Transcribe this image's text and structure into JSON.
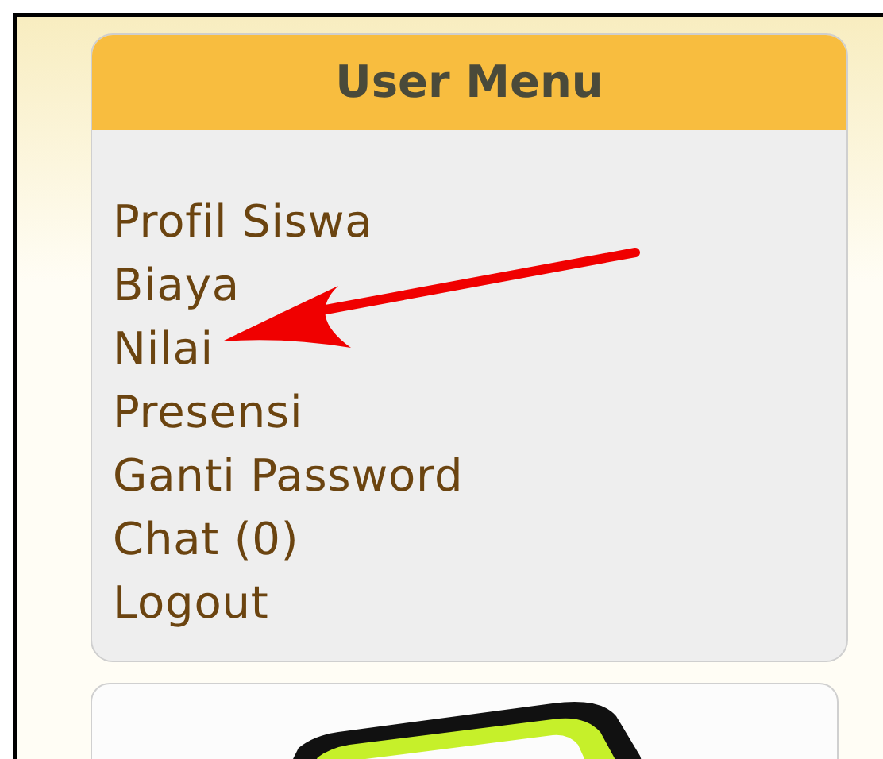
{
  "user_menu": {
    "title": "User Menu",
    "items": [
      {
        "label": "Profil Siswa"
      },
      {
        "label": "Biaya"
      },
      {
        "label": "Nilai"
      },
      {
        "label": "Presensi"
      },
      {
        "label": "Ganti Password"
      },
      {
        "label": "Chat (0)"
      },
      {
        "label": "Logout"
      }
    ]
  }
}
